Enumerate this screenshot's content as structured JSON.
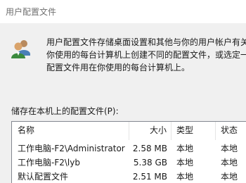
{
  "window": {
    "title": "用户配置文件"
  },
  "description": {
    "line1": "用户配置文件存储桌面设置和其他与你的用户帐户有关",
    "line2": "你使用的每台计算机上创建不同的配置文件，或选定一",
    "line3": "配置文件用在你使用的每台计算机上。"
  },
  "profiles": {
    "label": "储存在本机上的配置文件(P):",
    "columns": {
      "name": "名称",
      "size": "大小",
      "type": "类型",
      "status": "状态"
    },
    "rows": [
      {
        "name": "工作电脑-F2\\Administrator",
        "size": "2.58 MB",
        "type": "本地",
        "status": "本地"
      },
      {
        "name": "工作电脑-F2\\lyb",
        "size": "5.38 GB",
        "type": "本地",
        "status": "本地"
      },
      {
        "name": "默认配置文件",
        "size": "2.51 MB",
        "type": "本地",
        "status": "本地"
      }
    ]
  },
  "icons": {
    "users": "users-icon"
  },
  "colors": {
    "dialog_background": "#f0f0f0",
    "list_background": "#ffffff",
    "title_text": "#707070"
  }
}
